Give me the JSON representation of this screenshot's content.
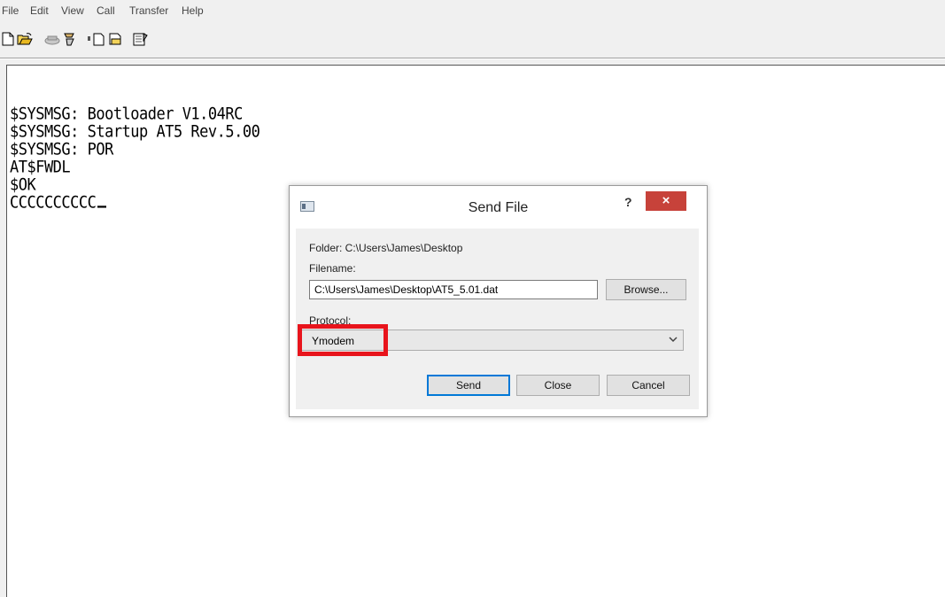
{
  "menu": [
    "File",
    "Edit",
    "View",
    "Call",
    "Transfer",
    "Help"
  ],
  "toolbar": {
    "icons": [
      "new-icon",
      "open-icon",
      "disconnect-icon",
      "connect-icon",
      "send-icon",
      "receive-icon",
      "properties-icon"
    ]
  },
  "terminal": {
    "lines": [
      "$SYSMSG: Bootloader V1.04RC",
      "$SYSMSG: Startup AT5 Rev.5.00",
      "$SYSMSG: POR",
      "AT$FWDL",
      "$OK",
      "CCCCCCCCCC"
    ]
  },
  "dialog": {
    "title": "Send File",
    "help": "?",
    "close": "×",
    "folder": "Folder: C:\\Users\\James\\Desktop",
    "filename_label": "Filename:",
    "filename_value": "C:\\Users\\James\\Desktop\\AT5_5.01.dat",
    "browse": "Browse...",
    "protocol_label": "Protocol:",
    "protocol_value": "Ymodem",
    "send": "Send",
    "close_button": "Close",
    "cancel": "Cancel"
  },
  "colors": {
    "highlight": "#e8141c",
    "close_button": "#c7423a",
    "focus": "#0078d7"
  }
}
